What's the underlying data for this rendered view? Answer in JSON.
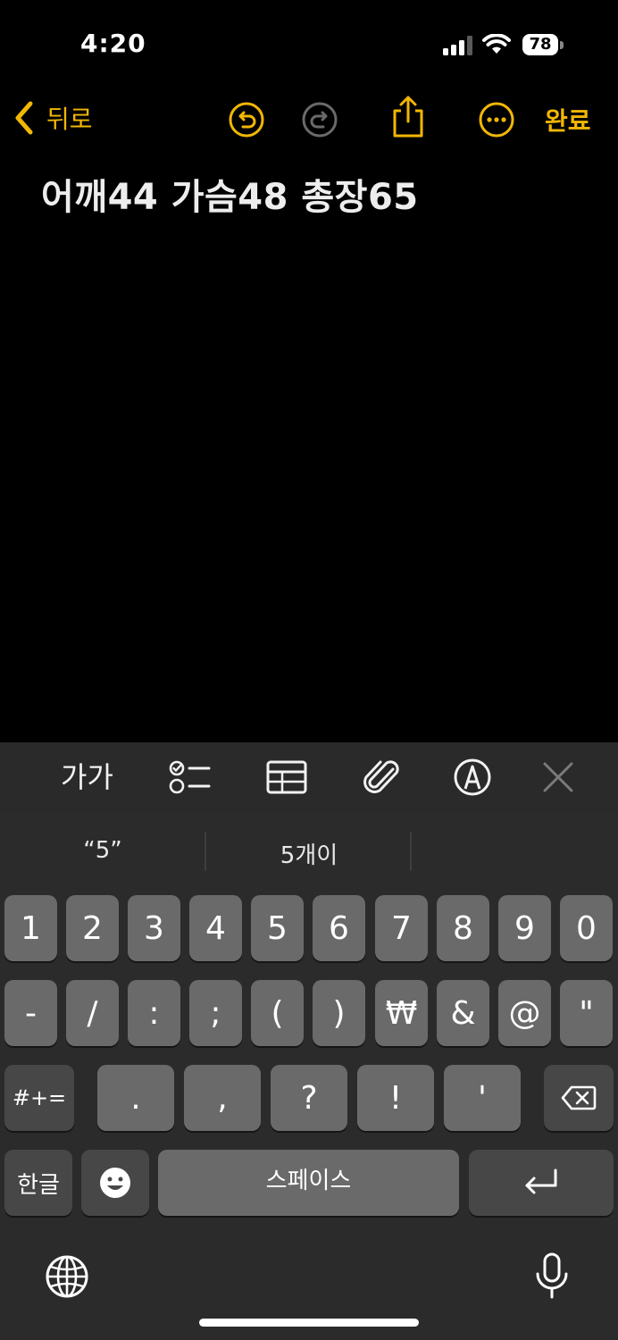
{
  "status": {
    "time": "4:20",
    "battery": "78"
  },
  "nav": {
    "back_label": "뒤로",
    "done_label": "완료"
  },
  "note": {
    "text": "어깨44 가슴48 총장65"
  },
  "toolbar": {
    "format_label": "가가"
  },
  "predictions": [
    "“5”",
    "5개이",
    ""
  ],
  "keyboard": {
    "row1": [
      "1",
      "2",
      "3",
      "4",
      "5",
      "6",
      "7",
      "8",
      "9",
      "0"
    ],
    "row2": [
      "-",
      "/",
      ":",
      ";",
      "(",
      ")",
      "₩",
      "&",
      "@",
      "\""
    ],
    "row3_mode": "#+=",
    "row3": [
      ".",
      ",",
      "?",
      "!",
      "'"
    ],
    "row4_lang": "한글",
    "space_label": "스페이스"
  },
  "colors": {
    "accent": "#f2b705",
    "key": "#6a6a6a",
    "key_dark": "#474747",
    "keyboard_bg": "#2b2b2b"
  }
}
